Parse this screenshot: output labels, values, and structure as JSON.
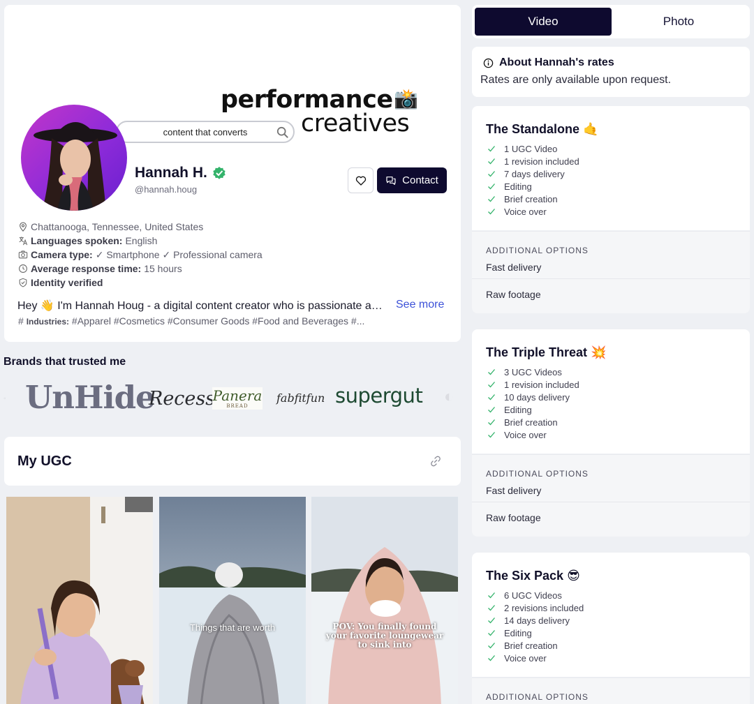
{
  "profile": {
    "banner_line1": "performance",
    "banner_line2": "creatives",
    "banner_search": "content that converts",
    "name": "Hannah H.",
    "handle": "@hannah.houg",
    "contact_label": "Contact",
    "location": "Chattanooga, Tennessee, United States",
    "languages_label": "Languages spoken:",
    "languages_value": "English",
    "camera_label": "Camera type:",
    "camera_value": "✓ Smartphone ✓ Professional camera",
    "response_label": "Average response time:",
    "response_value": "15 hours",
    "identity": "Identity verified",
    "bio": "Hey 👋 I'm Hannah Houg - a digital content creator who is passionate about creating",
    "see_more": "See more",
    "industries_label": "Industries:",
    "industries_value": "#Apparel #Cosmetics #Consumer Goods #Food and Beverages #..."
  },
  "brands": {
    "title": "Brands that trusted me",
    "items": [
      "UnHide",
      "Recess",
      "Panera",
      "BREAD",
      "fabfitfun",
      "supergut"
    ]
  },
  "ugc": {
    "title": "My UGC",
    "captions": [
      "Things that are worth",
      "POV: You finally found your favorite loungewear to sink into"
    ]
  },
  "tabs": {
    "video": "Video",
    "photo": "Photo"
  },
  "about": {
    "title": "About Hannah's rates",
    "text": "Rates are only available upon request."
  },
  "packages": [
    {
      "title": "The Standalone",
      "emoji": "🤙",
      "features": [
        "1 UGC Video",
        "1 revision included",
        "7 days delivery",
        "Editing",
        "Brief creation",
        "Voice over"
      ],
      "options_header": "ADDITIONAL OPTIONS",
      "options": [
        "Fast delivery",
        "Raw footage"
      ]
    },
    {
      "title": "The Triple Threat",
      "emoji": "💥",
      "features": [
        "3 UGC Videos",
        "1 revision included",
        "10 days delivery",
        "Editing",
        "Brief creation",
        "Voice over"
      ],
      "options_header": "ADDITIONAL OPTIONS",
      "options": [
        "Fast delivery",
        "Raw footage"
      ]
    },
    {
      "title": "The Six Pack",
      "emoji": "😎",
      "features": [
        "6 UGC Videos",
        "2 revisions included",
        "14 days delivery",
        "Editing",
        "Brief creation",
        "Voice over"
      ],
      "options_header": "ADDITIONAL OPTIONS"
    }
  ],
  "colors": {
    "accent_dark": "#0e0a2f",
    "check_green": "#34b36b",
    "link_blue": "#3c51d8",
    "avatar_ring": "#a332d4"
  }
}
